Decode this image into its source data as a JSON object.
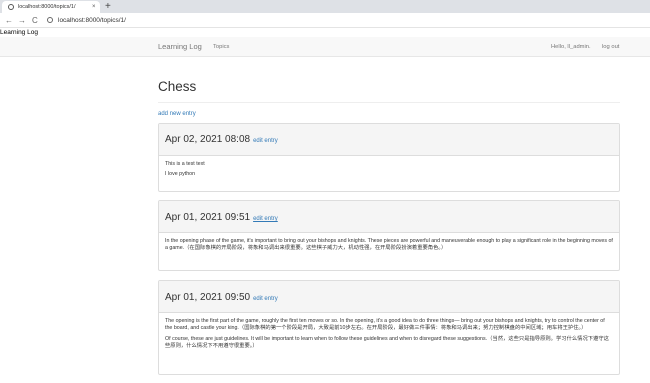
{
  "browser": {
    "tab_title": "localhost:8000/topics/1/",
    "tab_close": "×",
    "new_tab": "+",
    "back": "←",
    "forward": "→",
    "reload": "C",
    "url": "localhost:8000/topics/1/"
  },
  "page_title": "Learning Log",
  "navbar": {
    "brand": "Learning Log",
    "topics": "Topics",
    "greeting": "Hello, ll_admin.",
    "logout": "log out"
  },
  "topic": {
    "title": "Chess",
    "add_entry": "add new entry"
  },
  "entries": [
    {
      "date": "Apr 02, 2021 08:08",
      "edit": "edit entry",
      "paragraphs": [
        "This is a test text",
        "I love python"
      ]
    },
    {
      "date": "Apr 01, 2021 09:51",
      "edit": "edit entry",
      "paragraphs": [
        "In the opening phase of the game, it's important to bring out your bishops and knights. These pieces are powerful and maneuverable enough to play a significant role in the beginning moves of a game.（在国际象棋的开局阶段，将象和马调出来很重要。这些棋子威力大，机动性强，在开局阶段扮演着重要角色。）"
      ]
    },
    {
      "date": "Apr 01, 2021 09:50",
      "edit": "edit entry",
      "paragraphs": [
        "The opening is the first part of the game, roughly the first ten moves or so. In the opening, it's a good idea to do three things— bring out your bishops and knights, try to control the center of the board, and castle your king.（国际象棋的第一个阶段是开局，大致是前10步左右。在开局阶段，最好做三件事情：将象和马调出来；努力控制棋盘的中间区域；用车将王护住。）",
        "Of course, these are just guidelines. It will be important to learn when to follow these guidelines and when to disregard these suggestions.（当然，这些只是指导原则。学习什么情况下遵守这些原则，什么情况下不用遵守很重要。）"
      ]
    }
  ]
}
